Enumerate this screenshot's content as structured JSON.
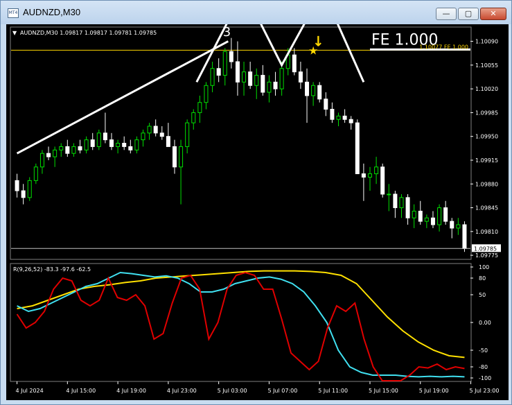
{
  "window": {
    "title": "AUDNZD,M30",
    "app_icon_text": "MT4",
    "min_glyph": "—",
    "max_glyph": "▢",
    "close_glyph": "✕"
  },
  "main_chart": {
    "header": "AUDNZD,M30  1.09817 1.09817 1.09781 1.09785",
    "wave_label": "3",
    "fe_big_label": "FE 1.000",
    "fe_line_label": "1.10077  FE 1.000",
    "current_price_label": "1.09785",
    "price_ticks": [
      "1.10090",
      "1.10055",
      "1.10020",
      "1.09985",
      "1.09950",
      "1.09915",
      "1.09880",
      "1.09845",
      "1.09810",
      "1.09775"
    ],
    "colors": {
      "bull": "#00e000",
      "bear": "#ffffff",
      "fe_line": "#ffd700",
      "price_line": "#c0c0c0"
    }
  },
  "indicator": {
    "header": "R(9,26,52) -83.3 -97.6 -62.5",
    "ticks": [
      "100",
      "80",
      "50",
      "0.00",
      "-50",
      "-80",
      "-100"
    ],
    "colors": {
      "red": "#e00000",
      "cyan": "#40e0f0",
      "yellow": "#ffe000"
    }
  },
  "time_axis": [
    "4 Jul 2024",
    "4 Jul 15:00",
    "4 Jul 19:00",
    "4 Jul 23:00",
    "5 Jul 03:00",
    "5 Jul 07:00",
    "5 Jul 11:00",
    "5 Jul 15:00",
    "5 Jul 19:00",
    "5 Jul 23:00"
  ],
  "chart_data": {
    "type": "candlestick",
    "symbol": "AUDNZD",
    "timeframe": "M30",
    "ylim": [
      1.0977,
      1.1011
    ],
    "candles_ohlc": [
      [
        1.09885,
        1.09895,
        1.0986,
        1.0987
      ],
      [
        1.0987,
        1.0988,
        1.0985,
        1.0986
      ],
      [
        1.0986,
        1.0989,
        1.09855,
        1.09885
      ],
      [
        1.09885,
        1.0991,
        1.0988,
        1.09905
      ],
      [
        1.09905,
        1.0993,
        1.09895,
        1.09925
      ],
      [
        1.09925,
        1.09935,
        1.09915,
        1.0992
      ],
      [
        1.0992,
        1.09935,
        1.09905,
        1.0993
      ],
      [
        1.0993,
        1.0994,
        1.0992,
        1.09935
      ],
      [
        1.09935,
        1.09945,
        1.0992,
        1.09925
      ],
      [
        1.09925,
        1.0994,
        1.0992,
        1.09935
      ],
      [
        1.09935,
        1.09945,
        1.09925,
        1.0993
      ],
      [
        1.0993,
        1.0995,
        1.09925,
        1.09945
      ],
      [
        1.09945,
        1.09955,
        1.0993,
        1.09935
      ],
      [
        1.09935,
        1.0996,
        1.0993,
        1.09955
      ],
      [
        1.09955,
        1.09985,
        1.0994,
        1.09945
      ],
      [
        1.09945,
        1.09955,
        1.0993,
        1.09935
      ],
      [
        1.09935,
        1.09945,
        1.09925,
        1.0994
      ],
      [
        1.0994,
        1.0995,
        1.0993,
        1.09935
      ],
      [
        1.09935,
        1.09945,
        1.09925,
        1.0993
      ],
      [
        1.0993,
        1.0995,
        1.09925,
        1.09945
      ],
      [
        1.09945,
        1.0996,
        1.09935,
        1.09955
      ],
      [
        1.09955,
        1.0997,
        1.09945,
        1.09965
      ],
      [
        1.09965,
        1.09975,
        1.0995,
        1.09955
      ],
      [
        1.09955,
        1.09965,
        1.09945,
        1.0995
      ],
      [
        1.0995,
        1.0997,
        1.09945,
        1.09935
      ],
      [
        1.09935,
        1.09945,
        1.09895,
        1.09905
      ],
      [
        1.09905,
        1.09945,
        1.0985,
        1.09935
      ],
      [
        1.09935,
        1.09975,
        1.09925,
        1.0997
      ],
      [
        1.0997,
        1.0999,
        1.0996,
        1.09985
      ],
      [
        1.09985,
        1.1001,
        1.0997,
        1.1
      ],
      [
        1.1,
        1.1003,
        1.0999,
        1.10025
      ],
      [
        1.10025,
        1.1006,
        1.10015,
        1.1005
      ],
      [
        1.1005,
        1.10065,
        1.1003,
        1.1004
      ],
      [
        1.1004,
        1.1008,
        1.10025,
        1.10075
      ],
      [
        1.10075,
        1.10095,
        1.1005,
        1.1006
      ],
      [
        1.1006,
        1.1009,
        1.1001,
        1.1003
      ],
      [
        1.1003,
        1.1006,
        1.1001,
        1.10045
      ],
      [
        1.10045,
        1.1006,
        1.1002,
        1.10025
      ],
      [
        1.10025,
        1.1005,
        1.10005,
        1.1004
      ],
      [
        1.1004,
        1.10055,
        1.1001,
        1.10015
      ],
      [
        1.10015,
        1.1004,
        1.1,
        1.1003
      ],
      [
        1.1003,
        1.10045,
        1.1001,
        1.1002
      ],
      [
        1.1002,
        1.1006,
        1.1001,
        1.1005
      ],
      [
        1.1005,
        1.1008,
        1.1004,
        1.1007
      ],
      [
        1.1007,
        1.1008,
        1.1004,
        1.10045
      ],
      [
        1.10045,
        1.1006,
        1.1002,
        1.1003
      ],
      [
        1.1003,
        1.1005,
        1.0997,
        1.1001
      ],
      [
        1.1001,
        1.1003,
        1.09995,
        1.10025
      ],
      [
        1.10025,
        1.1003,
        1.1,
        1.10005
      ],
      [
        1.10005,
        1.10015,
        1.0998,
        1.0999
      ],
      [
        1.0999,
        1.1,
        1.0997,
        1.09975
      ],
      [
        1.09975,
        1.09985,
        1.09965,
        1.0998
      ],
      [
        1.0998,
        1.0999,
        1.0997,
        1.09975
      ],
      [
        1.09975,
        1.0998,
        1.0996,
        1.0997
      ],
      [
        1.0997,
        1.09975,
        1.099,
        1.09895
      ],
      [
        1.09895,
        1.0991,
        1.09855,
        1.0989
      ],
      [
        1.0989,
        1.09905,
        1.0987,
        1.09895
      ],
      [
        1.09895,
        1.0992,
        1.0988,
        1.09905
      ],
      [
        1.09905,
        1.0991,
        1.0986,
        1.09865
      ],
      [
        1.09865,
        1.0988,
        1.0984,
        1.09865
      ],
      [
        1.09865,
        1.0987,
        1.0983,
        1.09845
      ],
      [
        1.09845,
        1.09865,
        1.0983,
        1.0986
      ],
      [
        1.0986,
        1.09865,
        1.0982,
        1.0983
      ],
      [
        1.0983,
        1.0985,
        1.09815,
        1.0984
      ],
      [
        1.0984,
        1.09855,
        1.0982,
        1.09825
      ],
      [
        1.09825,
        1.09835,
        1.09815,
        1.0983
      ],
      [
        1.0983,
        1.0984,
        1.09815,
        1.0982
      ],
      [
        1.0982,
        1.0985,
        1.0981,
        1.09845
      ],
      [
        1.09845,
        1.09855,
        1.0982,
        1.09825
      ],
      [
        1.09825,
        1.0983,
        1.098,
        1.09815
      ],
      [
        1.09815,
        1.0983,
        1.09805,
        1.0982
      ],
      [
        1.0982,
        1.09825,
        1.0978,
        1.09785
      ]
    ],
    "pattern_lines": [
      [
        [
          0.0,
          1.09925
        ],
        [
          33.5,
          1.1009
        ]
      ],
      [
        [
          28.5,
          1.1003
        ],
        [
          36.0,
          1.10165
        ],
        [
          42.0,
          1.10055
        ],
        [
          48.5,
          1.10165
        ],
        [
          55.0,
          1.1003
        ]
      ]
    ],
    "fe_level": 1.10077,
    "fe_line_range": [
      56.0,
      70.0
    ],
    "star_at": [
      47.0,
      1.10077
    ],
    "indicator_series": {
      "ylim": [
        -105,
        105
      ],
      "red": [
        15,
        -10,
        0,
        20,
        60,
        80,
        75,
        40,
        30,
        40,
        80,
        45,
        40,
        50,
        30,
        -30,
        -20,
        35,
        80,
        85,
        60,
        -30,
        0,
        60,
        85,
        90,
        85,
        60,
        60,
        5,
        -55,
        -70,
        -85,
        -70,
        -10,
        30,
        20,
        35,
        -30,
        -80,
        -105,
        -105,
        -105,
        -95,
        -80,
        -82,
        -75,
        -85,
        -80,
        -83
      ],
      "cyan": [
        30,
        20,
        25,
        35,
        45,
        55,
        65,
        70,
        80,
        90,
        88,
        85,
        82,
        84,
        80,
        70,
        55,
        55,
        60,
        70,
        75,
        80,
        82,
        78,
        70,
        55,
        30,
        0,
        -50,
        -80,
        -90,
        -95,
        -95,
        -95,
        -97,
        -98,
        -97,
        -98,
        -97,
        -98
      ],
      "yellow": [
        25,
        30,
        40,
        50,
        60,
        65,
        68,
        72,
        75,
        80,
        82,
        84,
        86,
        88,
        90,
        92,
        93,
        93,
        93,
        92,
        90,
        85,
        70,
        40,
        10,
        -15,
        -35,
        -50,
        -60,
        -63
      ]
    }
  }
}
